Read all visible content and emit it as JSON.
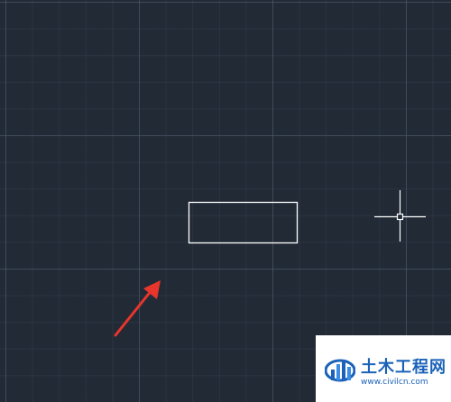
{
  "canvas": {
    "background_color": "#222a36",
    "grid_major_color": "#505c6e",
    "grid_minor_color": "#3c4656",
    "rectangle_stroke_color": "#ffffff",
    "crosshair_color": "#ffffff",
    "arrow_color": "#e8362c"
  },
  "watermark": {
    "title": "土木工程网",
    "url": "www.civilcn.com",
    "brand_color": "#1b62b8",
    "logo_icon": "civilcn-logo-icon"
  }
}
